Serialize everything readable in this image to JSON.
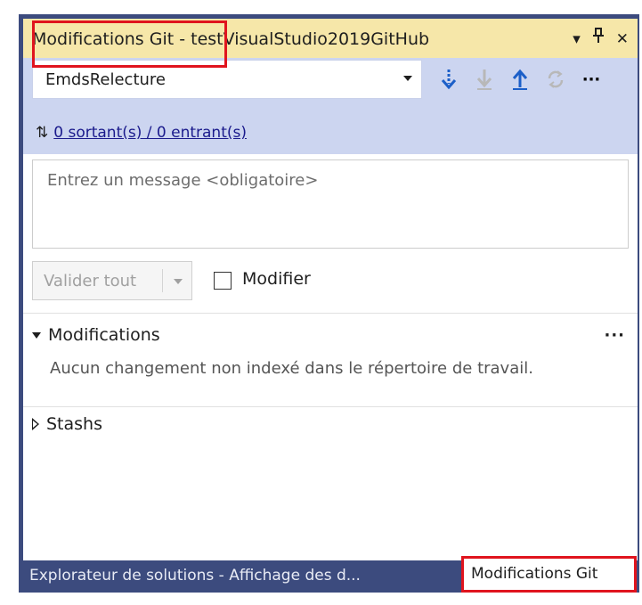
{
  "window": {
    "title": "Modifications Git - testVisualStudio2019GitHub",
    "dropdown_icon": "▾",
    "pin_icon": "ṇ",
    "close_icon": "✕"
  },
  "toolbar": {
    "branch": "EmdsRelecture",
    "fetch_icon": "fetch-down-arrow",
    "pull_icon": "pull-down-arrow",
    "push_icon": "push-up-arrow",
    "sync_icon": "sync",
    "more_label": "···"
  },
  "sync": {
    "arrows_icon": "⇅",
    "link_text": "0 sortant(s) / 0 entrant(s)"
  },
  "commit": {
    "message_placeholder": "Entrez un message <obligatoire>",
    "commit_all_label": "Valider tout",
    "amend_label": "Modifier"
  },
  "sections": {
    "changes": {
      "title": "Modifications",
      "more_label": "···",
      "empty_text": "Aucun changement non indexé dans le répertoire de travail."
    },
    "stashes": {
      "title": "Stashs"
    }
  },
  "tabs": {
    "solution_explorer": "Explorateur de solutions - Affichage des d...",
    "git_changes": "Modifications Git"
  },
  "colors": {
    "title_bar": "#f6e7a9",
    "toolbar_bg": "#ccd5f0",
    "frame": "#3c4b7e",
    "highlight": "#e0141e",
    "accent_icon": "#1c5fc8"
  }
}
